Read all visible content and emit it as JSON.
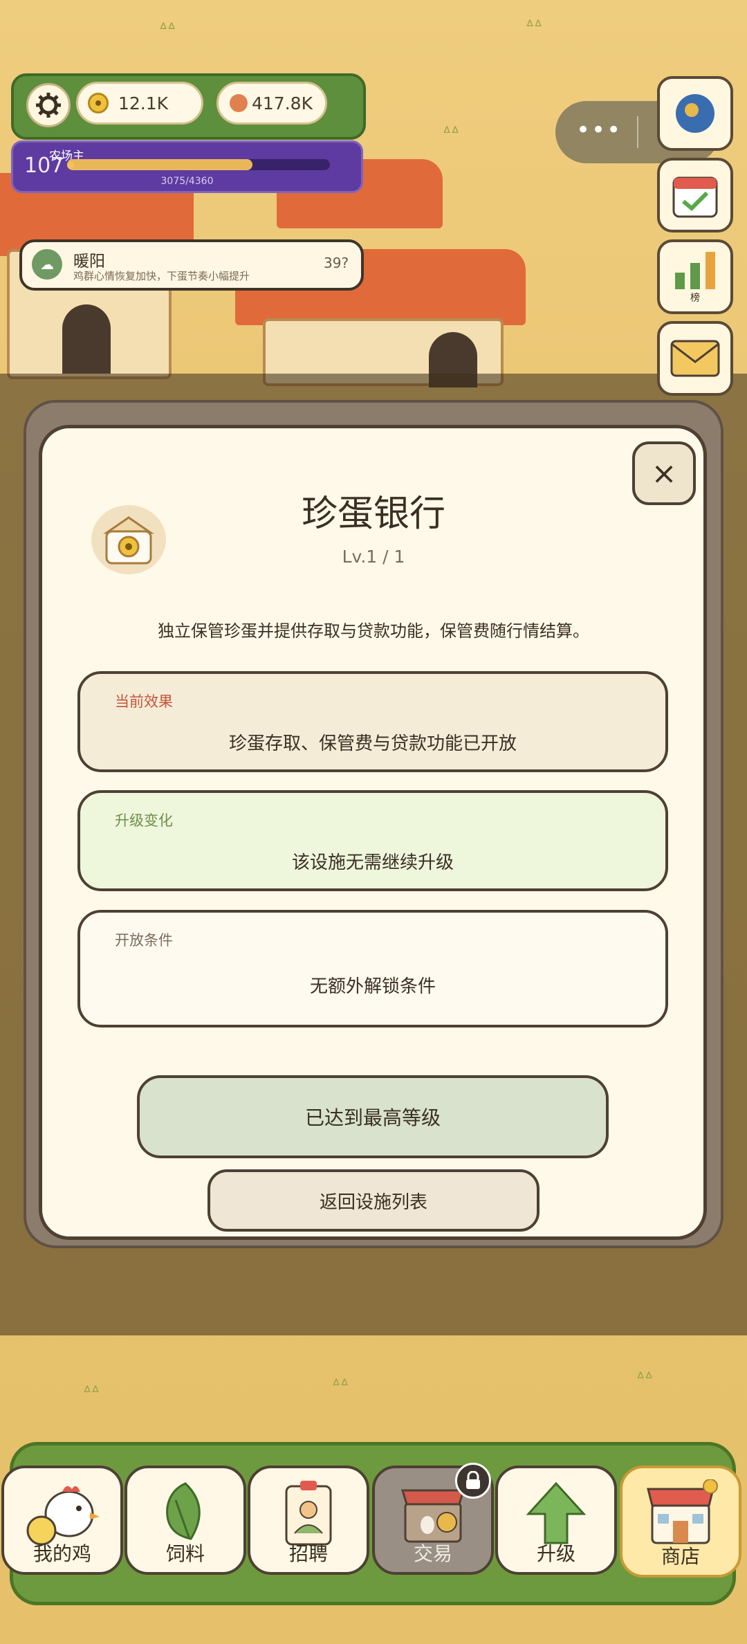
{
  "hud": {
    "gold": "12.1K",
    "eggs": "417.8K",
    "level": "107",
    "level_title": "农场主",
    "xp": "3075/4360",
    "xp_progress": 0.705
  },
  "weather": {
    "name": "暖阳",
    "description": "鸡群心情恢复加快，下蛋节奏小幅提升",
    "timer": "39?"
  },
  "side_menu": {
    "rank_label": "榜"
  },
  "modal": {
    "title": "珍蛋银行",
    "level": "Lv.1 / 1",
    "description": "独立保管珍蛋并提供存取与贷款功能，保管费随行情结算。",
    "close_glyph": "×",
    "current_effect": {
      "label": "当前效果",
      "value": "珍蛋存取、保管费与贷款功能已开放"
    },
    "upgrade_change": {
      "label": "升级变化",
      "value": "该设施无需继续升级"
    },
    "unlock_condition": {
      "label": "开放条件",
      "value": "无额外解锁条件"
    },
    "max_level_button": "已达到最高等级",
    "back_button": "返回设施列表"
  },
  "nav": {
    "items": [
      {
        "label": "我的鸡"
      },
      {
        "label": "饲料"
      },
      {
        "label": "招聘"
      },
      {
        "label": "交易"
      },
      {
        "label": "升级"
      },
      {
        "label": "商店"
      }
    ]
  },
  "colors": {
    "card_label_current": "#c4553c",
    "card_label_upgrade": "#6d8f4a",
    "card_label_unlock": "#7a6c5c"
  }
}
